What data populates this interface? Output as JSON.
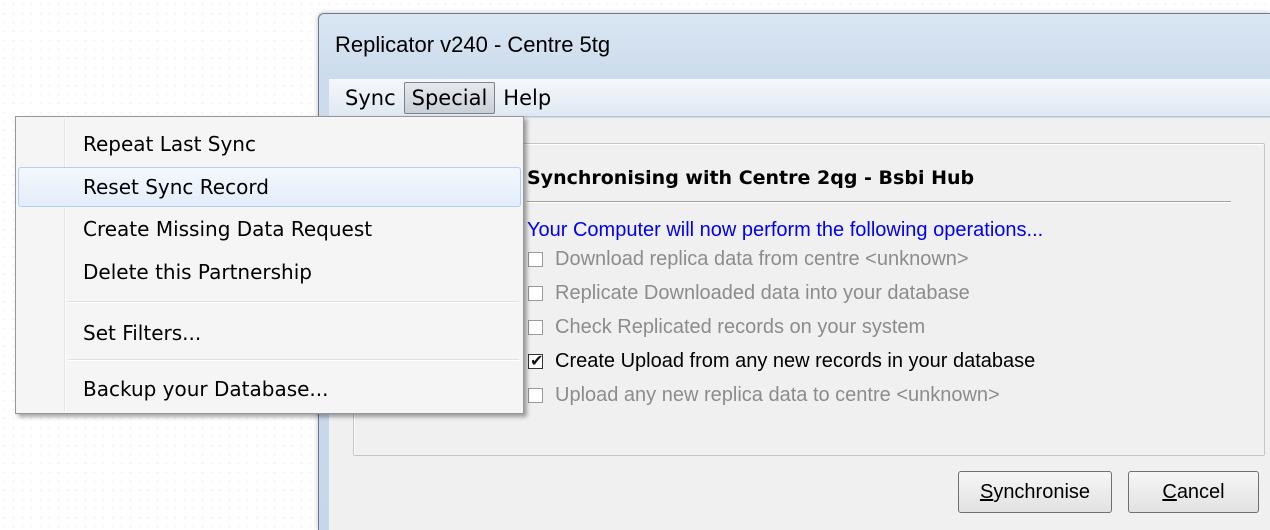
{
  "window": {
    "title": "Replicator v240 - Centre 5tg"
  },
  "menubar": {
    "items": [
      "Sync",
      "Special",
      "Help"
    ]
  },
  "dropdown": {
    "items": [
      "Repeat Last Sync",
      "Reset Sync Record",
      "Create Missing Data Request",
      "Delete this Partnership",
      "Set Filters...",
      "Backup your Database..."
    ]
  },
  "dialog": {
    "heading": "Synchronising with Centre 2qg - Bsbi Hub",
    "intro": "Your Computer will now perform the following operations...",
    "operations": [
      {
        "label": "Download replica data from centre <unknown>",
        "checked": false,
        "enabled": false
      },
      {
        "label": "Replicate Downloaded data into your database",
        "checked": false,
        "enabled": false
      },
      {
        "label": "Check Replicated records on your system",
        "checked": false,
        "enabled": false
      },
      {
        "label": "Create Upload from any new records in your database",
        "checked": true,
        "enabled": true
      },
      {
        "label": "Upload any new replica data to centre <unknown>",
        "checked": false,
        "enabled": false
      }
    ],
    "buttons": {
      "synchronise_first": "S",
      "synchronise_rest": "ynchronise",
      "cancel_first": "C",
      "cancel_rest": "ancel"
    }
  },
  "colors": {
    "intro_text": "#0000ee",
    "disabled_text": "#8c8c8c",
    "menu_hover": "#e3edf9"
  }
}
